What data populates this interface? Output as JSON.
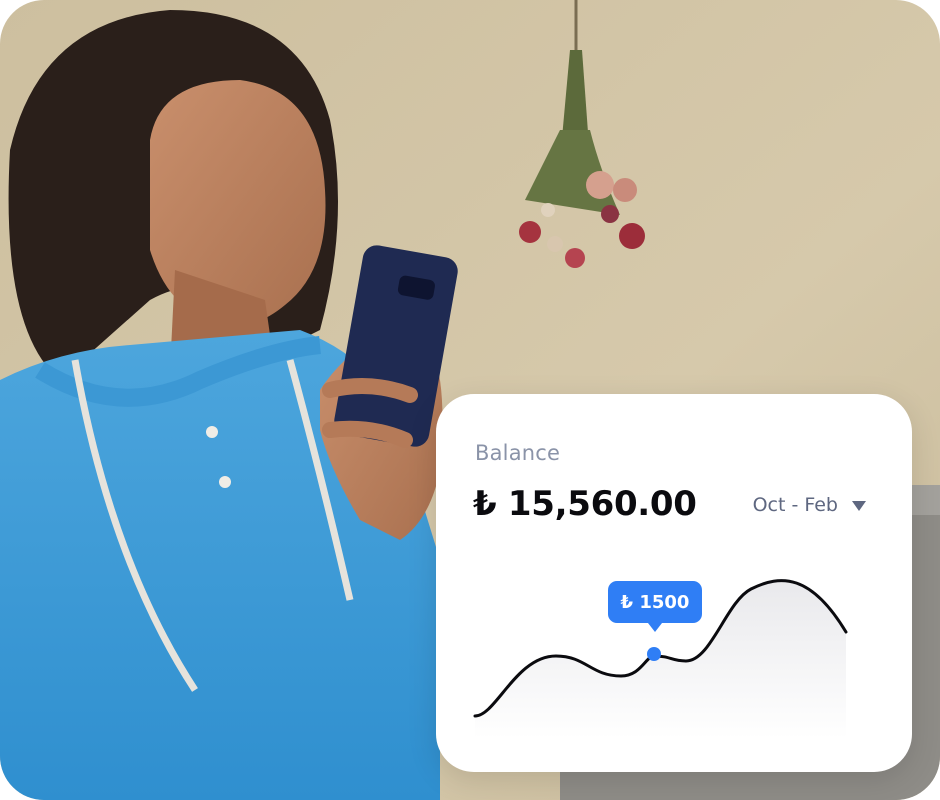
{
  "balance_card": {
    "label": "Balance",
    "amount": "₺ 15,560.00",
    "date_range": "Oct - Feb",
    "dropdown_icon": "caret-down-icon",
    "tooltip_value": "₺ 1500",
    "accent_color": "#2f7ef5"
  },
  "photo": {
    "subject": "woman-looking-at-phone"
  }
}
